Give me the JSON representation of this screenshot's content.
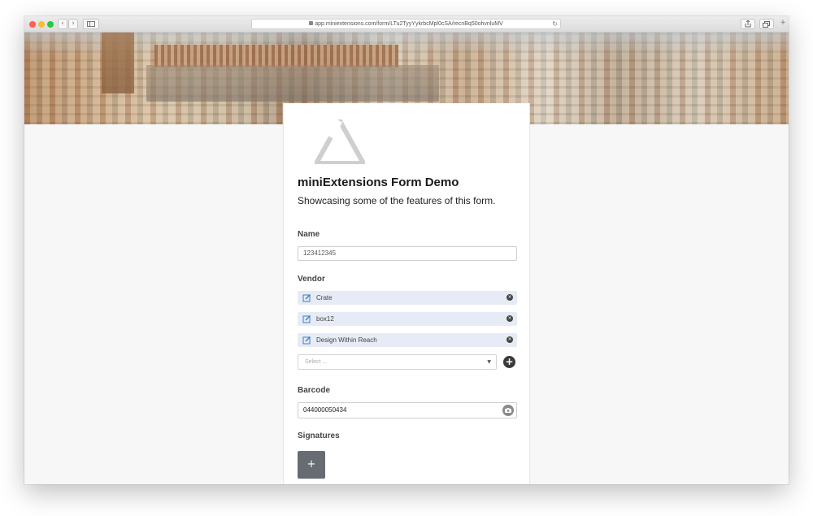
{
  "browser": {
    "url": "app.miniextensions.com/form/LTu2TyyYykrbcMpl0cSA/recnBq50ohvnluMV"
  },
  "form": {
    "title": "miniExtensions Form Demo",
    "subtitle": "Showcasing some of the features of this form.",
    "name_label": "Name",
    "name_value": "123412345",
    "vendor_label": "Vendor",
    "vendors": [
      "Crate",
      "box12",
      "Design Within Reach"
    ],
    "select_placeholder": "Select ...",
    "barcode_label": "Barcode",
    "barcode_value": "044000050434",
    "signatures_label": "Signatures",
    "signature_add": "+"
  },
  "icons": {
    "add_vendor": "plus-circle-icon",
    "remove_vendor": "remove-circle-icon",
    "edit_vendor": "edit-icon",
    "barcode_scan": "camera-icon",
    "logo": "triangle-logo-icon"
  }
}
